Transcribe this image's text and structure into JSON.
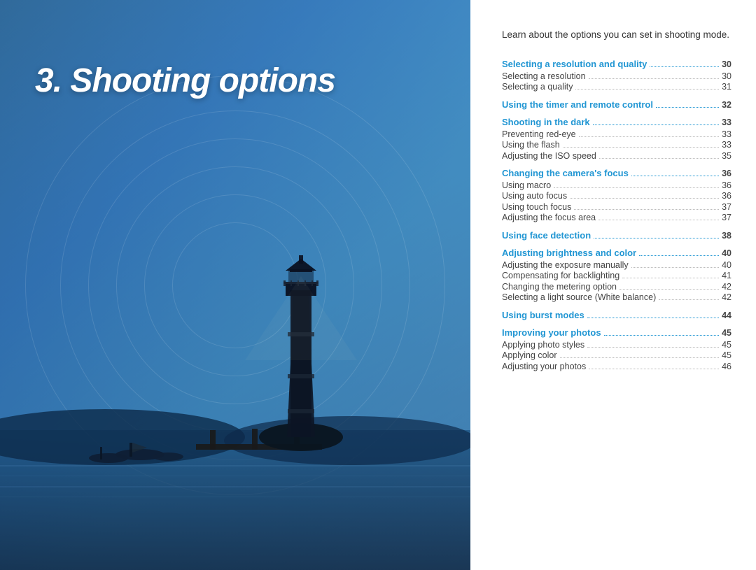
{
  "left": {
    "chapter_title": "3. Shooting options"
  },
  "right": {
    "description": "Learn about the options you can set in shooting mode.",
    "toc": [
      {
        "type": "header",
        "label": "Selecting a resolution and quality",
        "dots": true,
        "page": "30"
      },
      {
        "type": "item",
        "label": "Selecting a resolution",
        "dots": true,
        "page": "30"
      },
      {
        "type": "item",
        "label": "Selecting a quality",
        "dots": true,
        "page": "31"
      },
      {
        "type": "header",
        "label": "Using the timer and remote control",
        "dots": true,
        "page": "32"
      },
      {
        "type": "header",
        "label": "Shooting in the dark",
        "dots": true,
        "page": "33"
      },
      {
        "type": "item",
        "label": "Preventing red-eye",
        "dots": true,
        "page": "33"
      },
      {
        "type": "item",
        "label": "Using the flash",
        "dots": true,
        "page": "33"
      },
      {
        "type": "item",
        "label": "Adjusting the ISO speed",
        "dots": true,
        "page": "35"
      },
      {
        "type": "header",
        "label": "Changing the camera's focus",
        "dots": true,
        "page": "36"
      },
      {
        "type": "item",
        "label": "Using macro",
        "dots": true,
        "page": "36"
      },
      {
        "type": "item",
        "label": "Using auto focus",
        "dots": true,
        "page": "36"
      },
      {
        "type": "item",
        "label": "Using touch focus",
        "dots": true,
        "page": "37"
      },
      {
        "type": "item",
        "label": "Adjusting the focus area",
        "dots": true,
        "page": "37"
      },
      {
        "type": "header",
        "label": "Using face detection",
        "dots": true,
        "page": "38"
      },
      {
        "type": "header",
        "label": "Adjusting brightness and color",
        "dots": true,
        "page": "40"
      },
      {
        "type": "item",
        "label": "Adjusting the exposure manually",
        "dots": true,
        "page": "40"
      },
      {
        "type": "item",
        "label": "Compensating for backlighting",
        "dots": true,
        "page": "41"
      },
      {
        "type": "item",
        "label": "Changing the metering option",
        "dots": true,
        "page": "42"
      },
      {
        "type": "item",
        "label": "Selecting a light source (White balance)",
        "dots": true,
        "page": "42"
      },
      {
        "type": "header",
        "label": "Using burst modes",
        "dots": true,
        "page": "44"
      },
      {
        "type": "header",
        "label": "Improving your photos",
        "dots": true,
        "page": "45"
      },
      {
        "type": "item",
        "label": "Applying photo styles",
        "dots": true,
        "page": "45"
      },
      {
        "type": "item",
        "label": "Applying color",
        "dots": true,
        "page": "45"
      },
      {
        "type": "item",
        "label": "Adjusting your photos",
        "dots": true,
        "page": "46"
      }
    ]
  }
}
